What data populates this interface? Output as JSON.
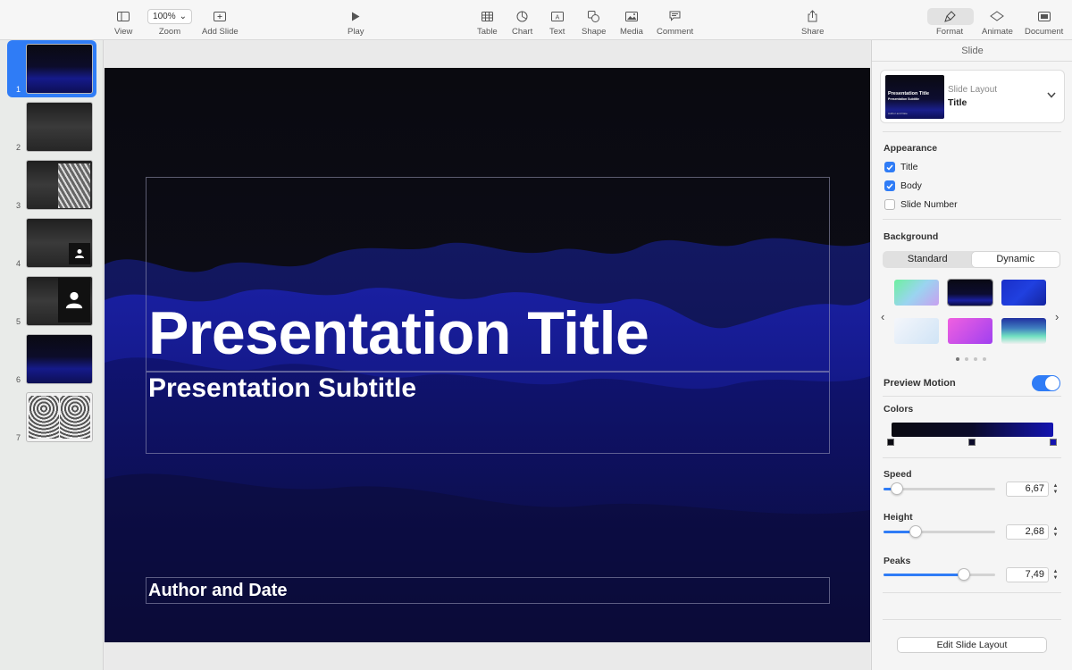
{
  "toolbar": {
    "view": "View",
    "zoom": "Zoom",
    "zoom_value": "100%",
    "add_slide": "Add Slide",
    "play": "Play",
    "table": "Table",
    "chart": "Chart",
    "text": "Text",
    "shape": "Shape",
    "media": "Media",
    "comment": "Comment",
    "share": "Share",
    "format": "Format",
    "animate": "Animate",
    "document": "Document"
  },
  "navigator": {
    "slides": [
      {
        "num": "1",
        "style": "blue",
        "selected": true
      },
      {
        "num": "2",
        "style": "gray"
      },
      {
        "num": "3",
        "style": "gray-architecture"
      },
      {
        "num": "4",
        "style": "gray-person-small"
      },
      {
        "num": "5",
        "style": "gray-person-large"
      },
      {
        "num": "6",
        "style": "blue"
      },
      {
        "num": "7",
        "style": "architecture-pair"
      }
    ]
  },
  "slide": {
    "title": "Presentation Title",
    "subtitle": "Presentation Subtitle",
    "author": "Author and Date"
  },
  "inspector": {
    "header": "Slide",
    "layout_label": "Slide Layout",
    "layout_value": "Title",
    "layout_thumb": {
      "title": "Presentation Title",
      "subtitle": "Presentation Subtitle",
      "author": "Author and Date"
    },
    "appearance_title": "Appearance",
    "appearance": {
      "title": {
        "label": "Title",
        "checked": true
      },
      "body": {
        "label": "Body",
        "checked": true
      },
      "slide_number": {
        "label": "Slide Number",
        "checked": false
      }
    },
    "background_title": "Background",
    "background_tabs": {
      "standard": "Standard",
      "dynamic": "Dynamic",
      "selected": "Dynamic"
    },
    "preview_motion": "Preview Motion",
    "preview_motion_on": true,
    "colors_title": "Colors",
    "gradient_colors": [
      "#0b0b12",
      "#0b0b2a",
      "#1414b0"
    ],
    "speed": {
      "label": "Speed",
      "value": "6,67",
      "fraction": 0.12
    },
    "height": {
      "label": "Height",
      "value": "2,68",
      "fraction": 0.29
    },
    "peaks": {
      "label": "Peaks",
      "value": "7,49",
      "fraction": 0.72
    },
    "edit_layout": "Edit Slide Layout"
  }
}
